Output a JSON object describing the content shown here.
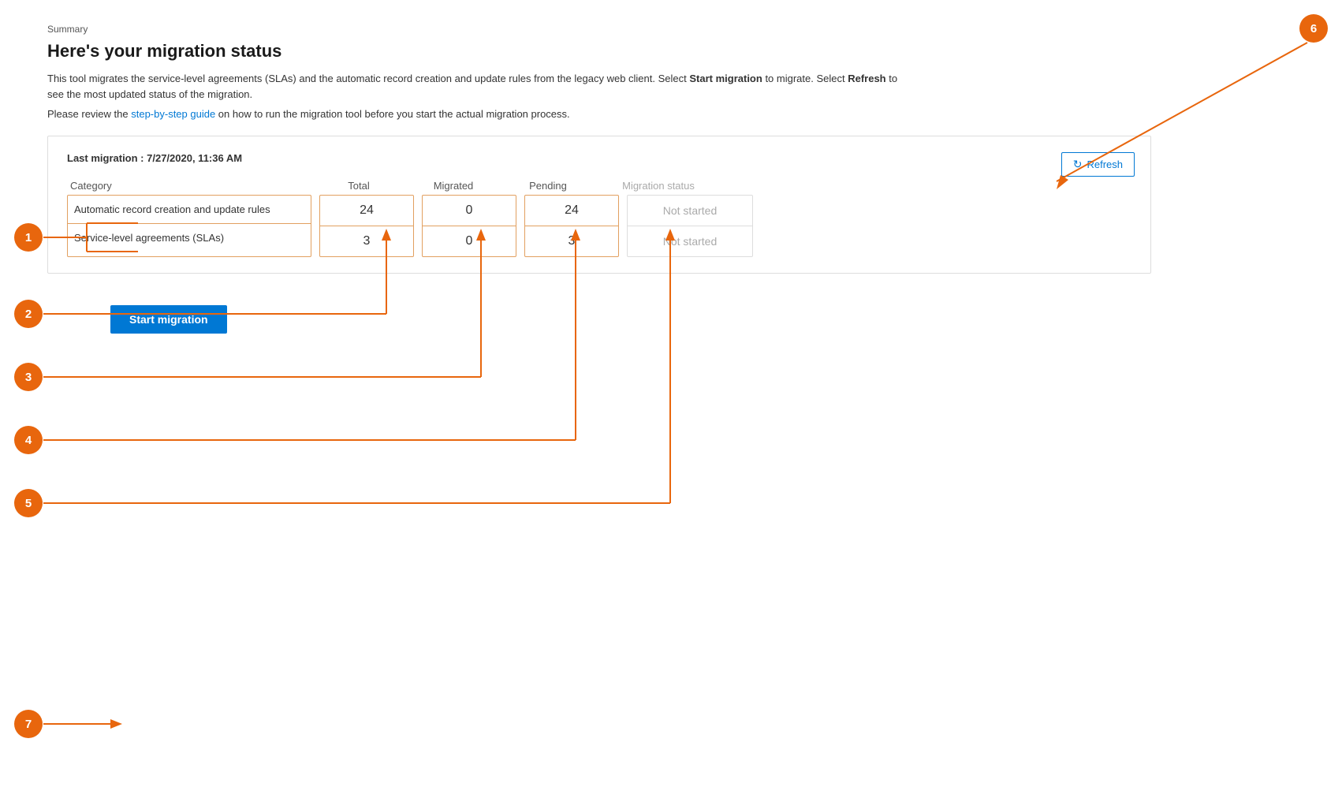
{
  "breadcrumb": "Summary",
  "page_title": "Here's your migration status",
  "description_part1": "This tool migrates the service-level agreements (SLAs) and the automatic record creation and update rules from the legacy web client. Select ",
  "description_bold1": "Start migration",
  "description_part2": " to migrate. Select ",
  "description_bold2": "Refresh",
  "description_part3": " to see the most updated status of the migration.",
  "guide_text_before": "Please review the ",
  "guide_link": "step-by-step guide",
  "guide_text_after": " on how to run the migration tool before you start the actual migration process.",
  "last_migration_label": "Last migration : 7/27/2020, 11:36 AM",
  "refresh_button": "Refresh",
  "table": {
    "columns": {
      "category": "Category",
      "total": "Total",
      "migrated": "Migrated",
      "pending": "Pending",
      "migration_status": "Migration status"
    },
    "rows": [
      {
        "category": "Automatic record creation and update rules",
        "total": "24",
        "migrated": "0",
        "pending": "24",
        "migration_status": "Not started"
      },
      {
        "category": "Service-level agreements (SLAs)",
        "total": "3",
        "migrated": "0",
        "pending": "3",
        "migration_status": "Not started"
      }
    ]
  },
  "start_migration_button": "Start migration",
  "annotations": {
    "1": "1",
    "2": "2",
    "3": "3",
    "4": "4",
    "5": "5",
    "6": "6",
    "7": "7"
  },
  "colors": {
    "orange": "#e8660d",
    "blue": "#0078d4",
    "border_orange": "#e2a060",
    "text_gray": "#aaa"
  }
}
